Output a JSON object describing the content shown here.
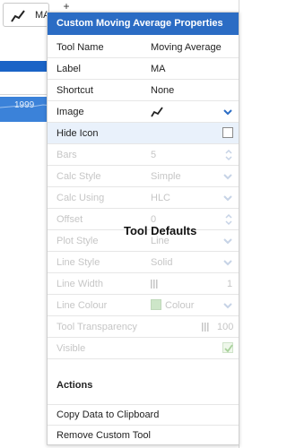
{
  "toolbar": {
    "chip_label": "MA",
    "chip_icon": "moving-average-line-icon",
    "plus_label": "+"
  },
  "background": {
    "year_label": "1999",
    "colors": {
      "blue_bar": "#1a63c6",
      "blue_band": "#3b82d9"
    }
  },
  "panel": {
    "title": "Custom Moving Average Properties",
    "header_color": "#2b6cc4",
    "rows": [
      {
        "label": "Tool Name",
        "value": "Moving Average"
      },
      {
        "label": "Label",
        "value": "MA"
      },
      {
        "label": "Shortcut",
        "value": "None"
      },
      {
        "label": "Image",
        "value_icon": "moving-average-line-icon",
        "control": "dropdown"
      },
      {
        "label": "Hide Icon",
        "control": "checkbox",
        "checked": false
      },
      {
        "label": "Bars",
        "value": "5",
        "control": "spinner",
        "disabled": true
      },
      {
        "label": "Calc Style",
        "value": "Simple",
        "control": "dropdown",
        "disabled": true
      },
      {
        "label": "Calc Using",
        "value": "HLC",
        "control": "dropdown",
        "disabled": true
      },
      {
        "label": "Offset",
        "value": "0",
        "control": "spinner",
        "disabled": true
      },
      {
        "label": "Plot Style",
        "value": "Line",
        "control": "dropdown",
        "disabled": true
      },
      {
        "label": "Line Style",
        "value": "Solid",
        "control": "dropdown",
        "disabled": true
      },
      {
        "label": "Line Width",
        "value": "1",
        "control": "slider",
        "disabled": true
      },
      {
        "label": "Line Colour",
        "value": "Colour",
        "control": "dropdown",
        "swatch": "#cde6c8",
        "disabled": true
      },
      {
        "label": "Tool Transparency",
        "value": "100",
        "control": "slider",
        "disabled": true
      },
      {
        "label": "Visible",
        "control": "checkbox",
        "checked": true,
        "disabled": true
      }
    ],
    "overlay_title": "Tool Defaults",
    "actions_heading": "Actions",
    "actions": [
      {
        "label": "Copy Data to Clipboard"
      },
      {
        "label": "Remove Custom Tool"
      }
    ]
  }
}
